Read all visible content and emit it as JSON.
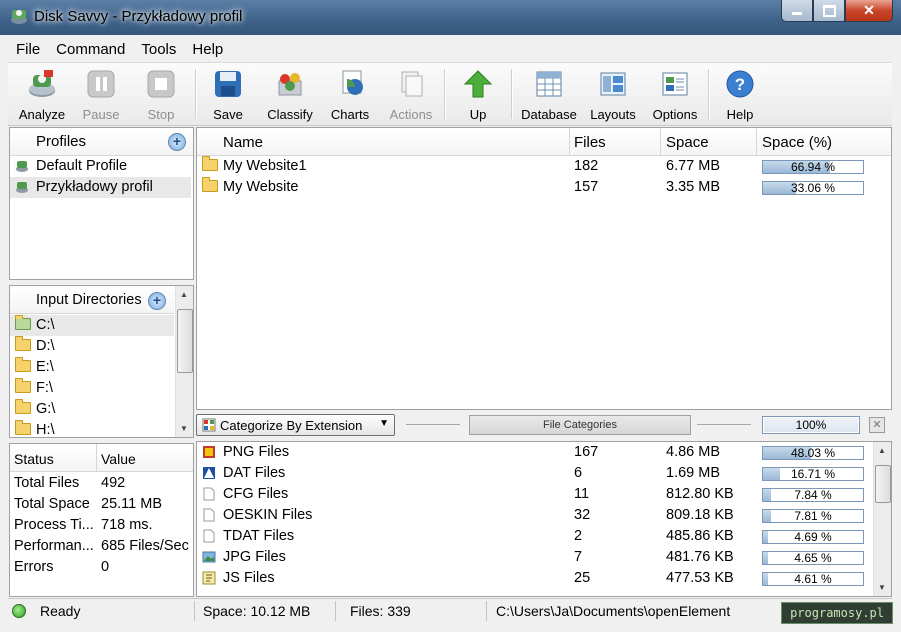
{
  "window": {
    "title": "Disk Savvy - Przykładowy profil"
  },
  "menu": [
    "File",
    "Command",
    "Tools",
    "Help"
  ],
  "toolbar": {
    "analyze": "Analyze",
    "pause": "Pause",
    "stop": "Stop",
    "save": "Save",
    "classify": "Classify",
    "charts": "Charts",
    "actions": "Actions",
    "up": "Up",
    "database": "Database",
    "layouts": "Layouts",
    "options": "Options",
    "help": "Help"
  },
  "profiles": {
    "header": "Profiles",
    "items": [
      "Default Profile",
      "Przykładowy profil"
    ]
  },
  "input_dirs": {
    "header": "Input Directories",
    "items": [
      "C:\\",
      "D:\\",
      "E:\\",
      "F:\\",
      "G:\\",
      "H:\\"
    ]
  },
  "stats": {
    "col_status": "Status",
    "col_value": "Value",
    "rows": [
      {
        "k": "Total Files",
        "v": "492"
      },
      {
        "k": "Total Space",
        "v": "25.11 MB"
      },
      {
        "k": "Process Ti...",
        "v": "718 ms."
      },
      {
        "k": "Performan...",
        "v": "685 Files/Sec"
      },
      {
        "k": "Errors",
        "v": "0"
      }
    ]
  },
  "dirs_table": {
    "cols": [
      "Name",
      "Files",
      "Space",
      "Space (%)"
    ],
    "rows": [
      {
        "name": "My Website1",
        "files": "182",
        "space": "6.77 MB",
        "pct": "66.94 %",
        "frac": 0.6694
      },
      {
        "name": "My Website",
        "files": "157",
        "space": "3.35 MB",
        "pct": "33.06 %",
        "frac": 0.3306
      }
    ]
  },
  "categorize": {
    "select": "Categorize By Extension",
    "button": "File Categories",
    "percent": "100%"
  },
  "ext_table": {
    "rows": [
      {
        "name": "PNG Files",
        "files": "167",
        "space": "4.86 MB",
        "pct": "48.03 %",
        "frac": 0.4803,
        "icon": "png-icon"
      },
      {
        "name": "DAT Files",
        "files": "6",
        "space": "1.69 MB",
        "pct": "16.71 %",
        "frac": 0.1671,
        "icon": "dat-icon"
      },
      {
        "name": "CFG Files",
        "files": "11",
        "space": "812.80 KB",
        "pct": "7.84 %",
        "frac": 0.0784,
        "icon": "file-icon"
      },
      {
        "name": "OESKIN Files",
        "files": "32",
        "space": "809.18 KB",
        "pct": "7.81 %",
        "frac": 0.0781,
        "icon": "file-icon"
      },
      {
        "name": "TDAT Files",
        "files": "2",
        "space": "485.86 KB",
        "pct": "4.69 %",
        "frac": 0.0469,
        "icon": "file-icon"
      },
      {
        "name": "JPG Files",
        "files": "7",
        "space": "481.76 KB",
        "pct": "4.65 %",
        "frac": 0.0465,
        "icon": "image-icon"
      },
      {
        "name": "JS Files",
        "files": "25",
        "space": "477.53 KB",
        "pct": "4.61 %",
        "frac": 0.0461,
        "icon": "script-icon"
      }
    ]
  },
  "statusbar": {
    "state": "Ready",
    "space": "Space: 10.12 MB",
    "files": "Files: 339",
    "path": "C:\\Users\\Ja\\Documents\\openElement"
  },
  "watermark": "programosy.pl"
}
